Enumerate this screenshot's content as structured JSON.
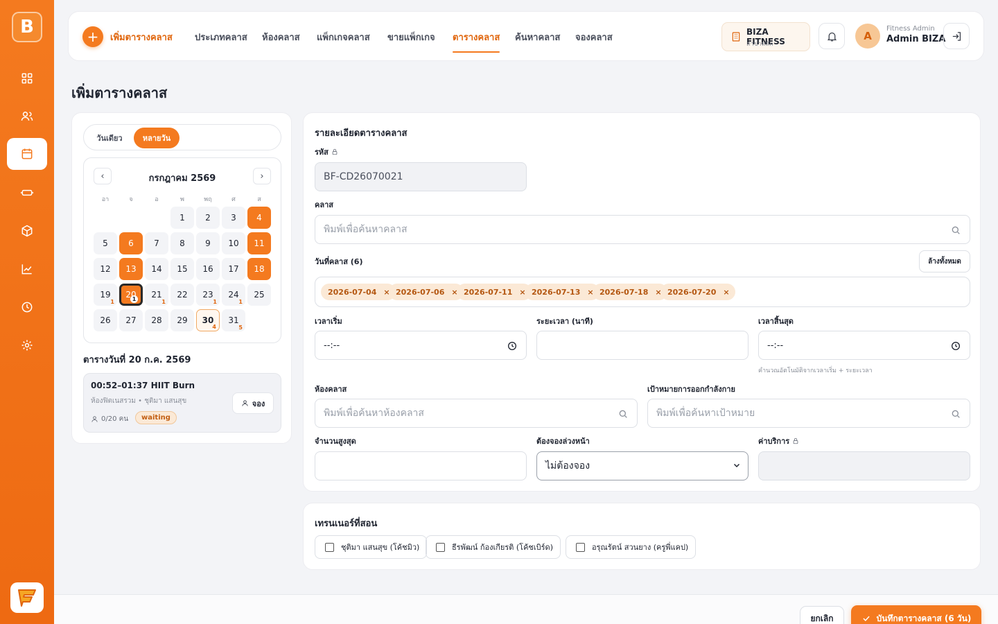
{
  "colors": {
    "accent": "#f47a1f",
    "accent_dark": "#e0650c",
    "tag_bg": "#fbe9d6"
  },
  "sidebar": {
    "logo_letter": "B",
    "items": [
      {
        "icon": "grid-icon"
      },
      {
        "icon": "users-icon"
      },
      {
        "icon": "calendar-icon",
        "active": true
      },
      {
        "icon": "ticket-icon"
      },
      {
        "icon": "box-icon"
      },
      {
        "icon": "chart-icon"
      },
      {
        "icon": "clock-icon"
      },
      {
        "icon": "gear-icon"
      }
    ]
  },
  "header": {
    "add_label": "เพิ่มตารางคลาส",
    "tabs": [
      {
        "label": "ประเภทคลาส"
      },
      {
        "label": "ห้องคลาส"
      },
      {
        "label": "แพ็กเกจคลาส"
      },
      {
        "label": "ขายแพ็กเกจ"
      },
      {
        "label": "ตารางคลาส",
        "active": true
      },
      {
        "label": "ค้นหาคลาส"
      },
      {
        "label": "จองคลาส"
      }
    ],
    "org_name": "BIZA FITNESS",
    "org_branch": "สาขาหลัก",
    "avatar_letter": "A",
    "user_role": "Fitness Admin",
    "user_name": "Admin BIZA"
  },
  "page_title": "เพิ่มตารางคลาส",
  "mode_toggle": {
    "single": "วันเดียว",
    "multi": "หลายวัน"
  },
  "calendar": {
    "month": "กรกฎาคม 2569",
    "prev": "‹",
    "next": "›",
    "weekdays": [
      "อา",
      "จ",
      "อ",
      "พ",
      "พฤ",
      "ศ",
      "ส"
    ],
    "days": [
      {
        "d": "1"
      },
      {
        "d": "2"
      },
      {
        "d": "3"
      },
      {
        "d": "4",
        "sel": true
      },
      {
        "d": "5"
      },
      {
        "d": "6",
        "sel": true
      },
      {
        "d": "7"
      },
      {
        "d": "8"
      },
      {
        "d": "9"
      },
      {
        "d": "10"
      },
      {
        "d": "11",
        "sel": true
      },
      {
        "d": "12"
      },
      {
        "d": "13",
        "sel": true
      },
      {
        "d": "14"
      },
      {
        "d": "15"
      },
      {
        "d": "16"
      },
      {
        "d": "17"
      },
      {
        "d": "18",
        "sel": true
      },
      {
        "d": "19",
        "cnt": "1"
      },
      {
        "d": "20",
        "today": true,
        "sel": true,
        "cnt": "1"
      },
      {
        "d": "21",
        "cnt": "1"
      },
      {
        "d": "22"
      },
      {
        "d": "23",
        "cnt": "1"
      },
      {
        "d": "24",
        "cnt": "1"
      },
      {
        "d": "25"
      },
      {
        "d": "26"
      },
      {
        "d": "27"
      },
      {
        "d": "28"
      },
      {
        "d": "29"
      },
      {
        "d": "30",
        "bold": true,
        "cnt": "4"
      },
      {
        "d": "31",
        "cnt": "5"
      }
    ]
  },
  "schedule": {
    "title": "ตารางวันที่ 20 ก.ค. 2569",
    "items": [
      {
        "title": "00:52–01:37 HIIT Burn",
        "subtitle": "ห้องฟิตเนสรวม • ชุติมา แสนสุข",
        "capacity": "0/20 คน",
        "status": "waiting",
        "book_label": "จอง"
      }
    ]
  },
  "form": {
    "section_title": "รายละเอียดตารางคลาส",
    "code_label": "รหัส",
    "code_value": "BF-CD26070021",
    "class_label": "คลาส",
    "class_placeholder": "พิมพ์เพื่อค้นหาคลาส",
    "dates_label": "วันที่คลาส (6)",
    "clear_all": "ล้างทั้งหมด",
    "dates": [
      "2026-07-04",
      "2026-07-06",
      "2026-07-11",
      "2026-07-13",
      "2026-07-18",
      "2026-07-20"
    ],
    "tag_remove": "×",
    "start_label": "เวลาเริ่ม",
    "start_value": "--:--",
    "duration_label": "ระยะเวลา (นาที)",
    "duration_value": "",
    "end_label": "เวลาสิ้นสุด",
    "end_value": "--:--",
    "end_hint": "คำนวณอัตโนมัติจากเวลาเริ่ม + ระยะเวลา",
    "room_label": "ห้องคลาส",
    "room_placeholder": "พิมพ์เพื่อค้นหาห้องคลาส",
    "goal_label": "เป้าหมายการออกกำลังกาย",
    "goal_placeholder": "พิมพ์เพื่อค้นหาเป้าหมาย",
    "max_label": "จำนวนสูงสุด",
    "max_value": "",
    "advance_label": "ต้องจองล่วงหน้า",
    "advance_value": "ไม่ต้องจอง",
    "fee_label": "ค่าบริการ",
    "fee_value": ""
  },
  "trainers": {
    "title": "เทรนเนอร์ที่สอน",
    "items": [
      {
        "label": "ชุติมา แสนสุข (โค้ชมิว)"
      },
      {
        "label": "ธีรพัฒน์ ก้องเกียรติ (โค้ชเบิร์ด)"
      },
      {
        "label": "อรุณรัตน์ สวนยาง (ครูพี่แคป)"
      }
    ]
  },
  "footer": {
    "cancel": "ยกเลิก",
    "save": "บันทึกตารางคลาส (6 วัน)"
  }
}
